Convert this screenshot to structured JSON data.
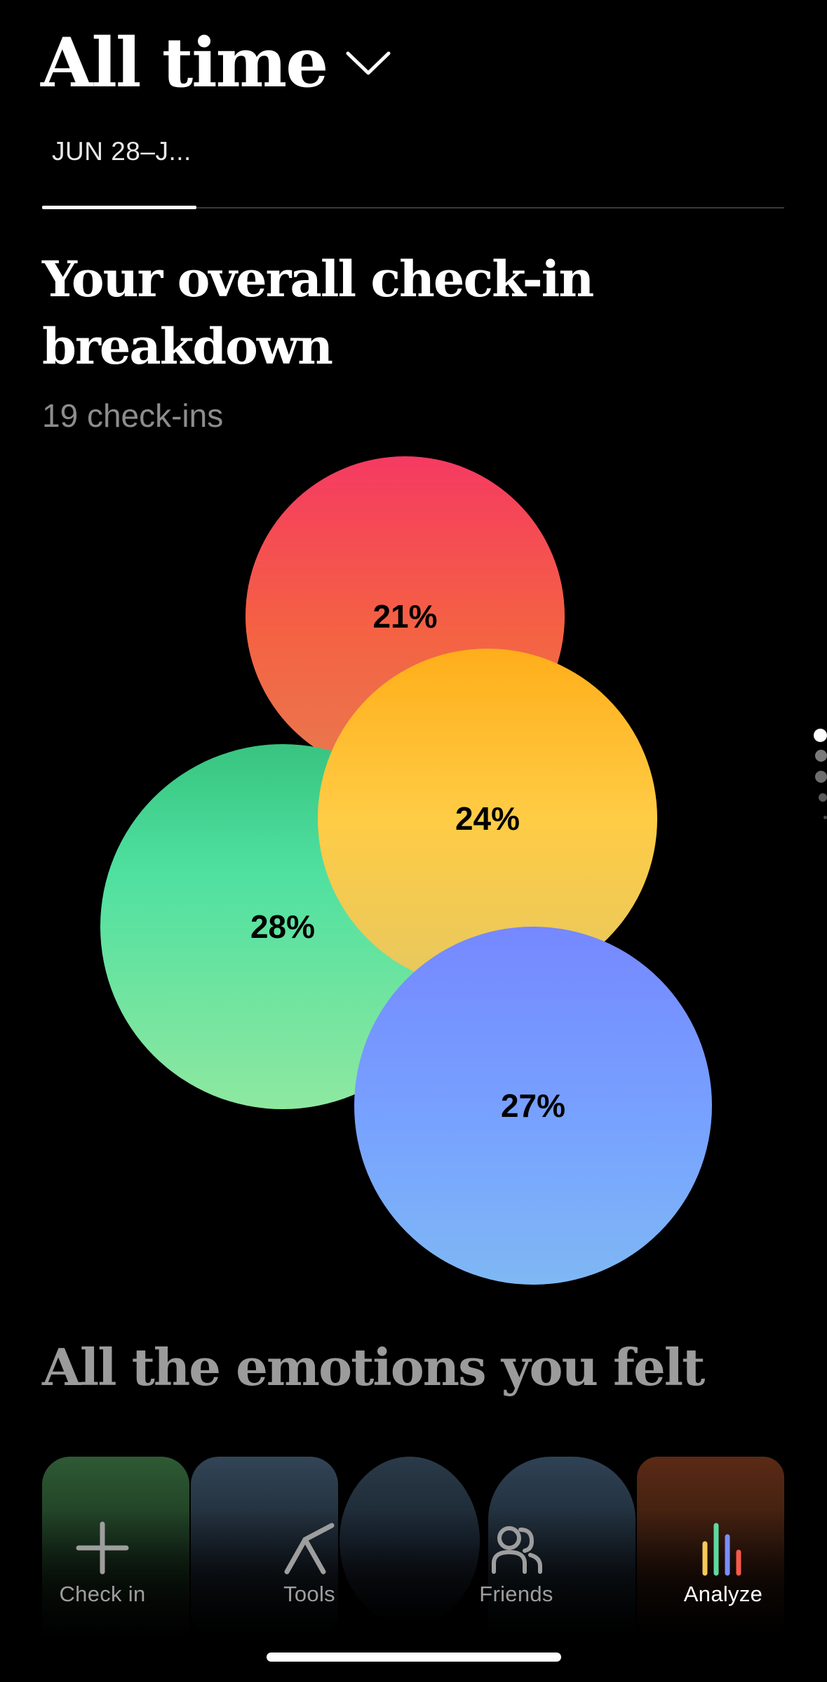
{
  "header": {
    "title": "All time",
    "date_range": "JUN 28–J..."
  },
  "overview": {
    "title": "Your overall check-in breakdown",
    "count_text": "19 check-ins"
  },
  "chart_data": {
    "type": "bubble",
    "values": [
      21,
      24,
      28,
      27
    ],
    "labels": [
      "21%",
      "24%",
      "28%",
      "27%"
    ],
    "colors": [
      "#f5475a",
      "#ffbe2e",
      "#45d994",
      "#779bff"
    ]
  },
  "emotions": {
    "title": "All the emotions you felt"
  },
  "pager": {
    "count": 5,
    "active": 0
  },
  "tabbar": {
    "items": [
      {
        "label": "Check in",
        "icon": "plus-icon"
      },
      {
        "label": "Tools",
        "icon": "tools-icon"
      },
      {
        "label": "Friends",
        "icon": "friends-icon"
      },
      {
        "label": "Analyze",
        "icon": "analyze-icon"
      }
    ],
    "active": 3
  }
}
